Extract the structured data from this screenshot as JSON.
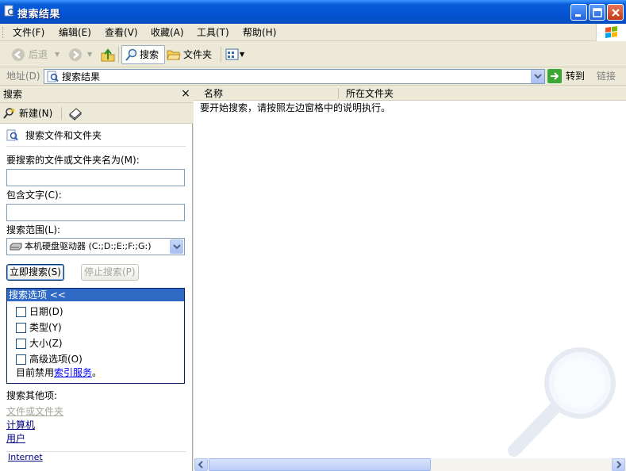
{
  "window": {
    "title": "搜索结果"
  },
  "menu": [
    {
      "label": "文件(F)"
    },
    {
      "label": "编辑(E)"
    },
    {
      "label": "查看(V)"
    },
    {
      "label": "收藏(A)"
    },
    {
      "label": "工具(T)"
    },
    {
      "label": "帮助(H)"
    }
  ],
  "toolbar": {
    "back_label": "后退",
    "search_label": "搜索",
    "folders_label": "文件夹"
  },
  "address": {
    "label": "地址(D)",
    "value": "搜索结果",
    "go_label": "转到",
    "links_label": "链接"
  },
  "search_pane": {
    "title": "搜索",
    "new_label": "新建(N)",
    "section_title": "搜索文件和文件夹",
    "name_label": "要搜索的文件或文件夹名为(M):",
    "name_value": "",
    "text_label": "包含文字(C):",
    "text_value": "",
    "scope_label": "搜索范围(L):",
    "scope_value": "本机硬盘驱动器 (C:;D:;E:;F:;G:)",
    "search_now": "立即搜索(S)",
    "stop_search": "停止搜索(P)",
    "options_title": "搜索选项 <<",
    "options": [
      {
        "label": "日期(D)"
      },
      {
        "label": "类型(Y)"
      },
      {
        "label": "大小(Z)"
      },
      {
        "label": "高级选项(O)"
      }
    ],
    "index_note_prefix": "目前禁用",
    "index_note_link": "索引服务",
    "index_note_suffix": "。",
    "other_heading": "搜索其他项:",
    "other_items": [
      {
        "label": "文件或文件夹"
      },
      {
        "label": "计算机"
      },
      {
        "label": "用户"
      }
    ],
    "internet": "Internet"
  },
  "results": {
    "columns": [
      {
        "label": "名称"
      },
      {
        "label": "所在文件夹"
      }
    ],
    "hint": "要开始搜索，请按照左边窗格中的说明执行。"
  },
  "colors": {
    "titlebar": "#0454D6",
    "options_header": "#316AC5",
    "link": "#0000FF"
  }
}
